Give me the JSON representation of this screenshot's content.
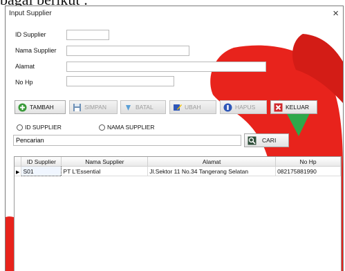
{
  "page_caption": "bagai berikut :",
  "window": {
    "title": "Input Supplier",
    "close_glyph": "×"
  },
  "form": {
    "id_supplier_label": "ID Supplier",
    "nama_supplier_label": "Nama Supplier",
    "alamat_label": "Alamat",
    "no_hp_label": "No Hp",
    "id_supplier_value": "",
    "nama_supplier_value": "",
    "alamat_value": "",
    "no_hp_value": ""
  },
  "toolbar": {
    "tambah": "TAMBAH",
    "simpan": "SIMPAN",
    "batal": "BATAL",
    "ubah": "UBAH",
    "hapus": "HAPUS",
    "keluar": "KELUAR"
  },
  "search": {
    "radio_id": "ID SUPPLIER",
    "radio_nama": "NAMA SUPPLIER",
    "value": "Pencarian",
    "cari_label": "CARI"
  },
  "table": {
    "columns": [
      "ID Supplier",
      "Nama Supplier",
      "Alamat",
      "No Hp"
    ],
    "rows": [
      [
        "S01",
        "PT L'Essential",
        "Jl.Sektor 11 No.34 Tangerang Selatan",
        "082175881990"
      ]
    ]
  },
  "colors": {
    "accent_red": "#e8231c",
    "decor_green": "#2fa84a",
    "tambah_icon": "#3a9a3a",
    "keluar_icon": "#d0282c",
    "hapus_icon": "#2f57b8"
  }
}
